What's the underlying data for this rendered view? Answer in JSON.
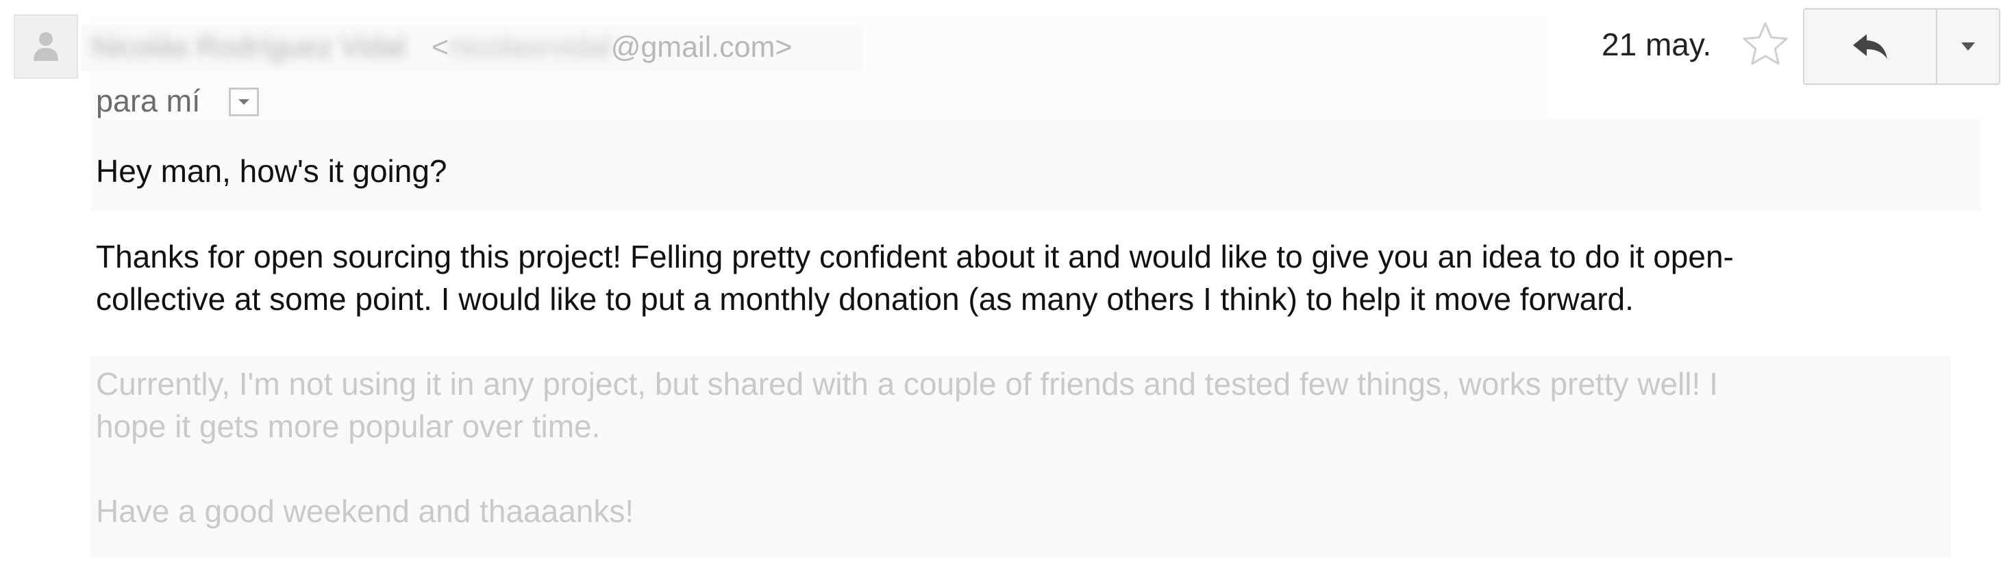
{
  "sender": {
    "name": "Nicolás Rodríguez Vidal",
    "email_open": "<",
    "email_user": "nicolasrvidal",
    "email_domain": "@gmail.com",
    "email_close": ">",
    "avatar_icon": "person-icon"
  },
  "recipient": {
    "label": "para mí",
    "toggle_icon": "dropdown-arrow-icon"
  },
  "actions": {
    "date": "21 may.",
    "star_icon": "star-outline-icon",
    "reply_icon": "reply-arrow-icon",
    "more_icon": "caret-down-icon"
  },
  "body": {
    "greeting": "Hey man, how's it going?",
    "para1_line1": "Thanks for open sourcing this project! Felling pretty confident about it and would like to give you an idea to do it open-",
    "para1_line2": "collective at some point. I would like to put a monthly donation (as many others I think) to help it move forward.",
    "para2_line1": "Currently, I'm not using it in any project, but shared with a couple of friends and tested few things, works pretty well! I",
    "para2_line2": "hope it gets more popular over time.",
    "closing": "Have a good weekend and thaaaanks!"
  },
  "colors": {
    "text_dark": "#111111",
    "text_faded": "#c9c9c9",
    "text_muted": "#6c6c6c",
    "border": "#d6d6d6"
  }
}
